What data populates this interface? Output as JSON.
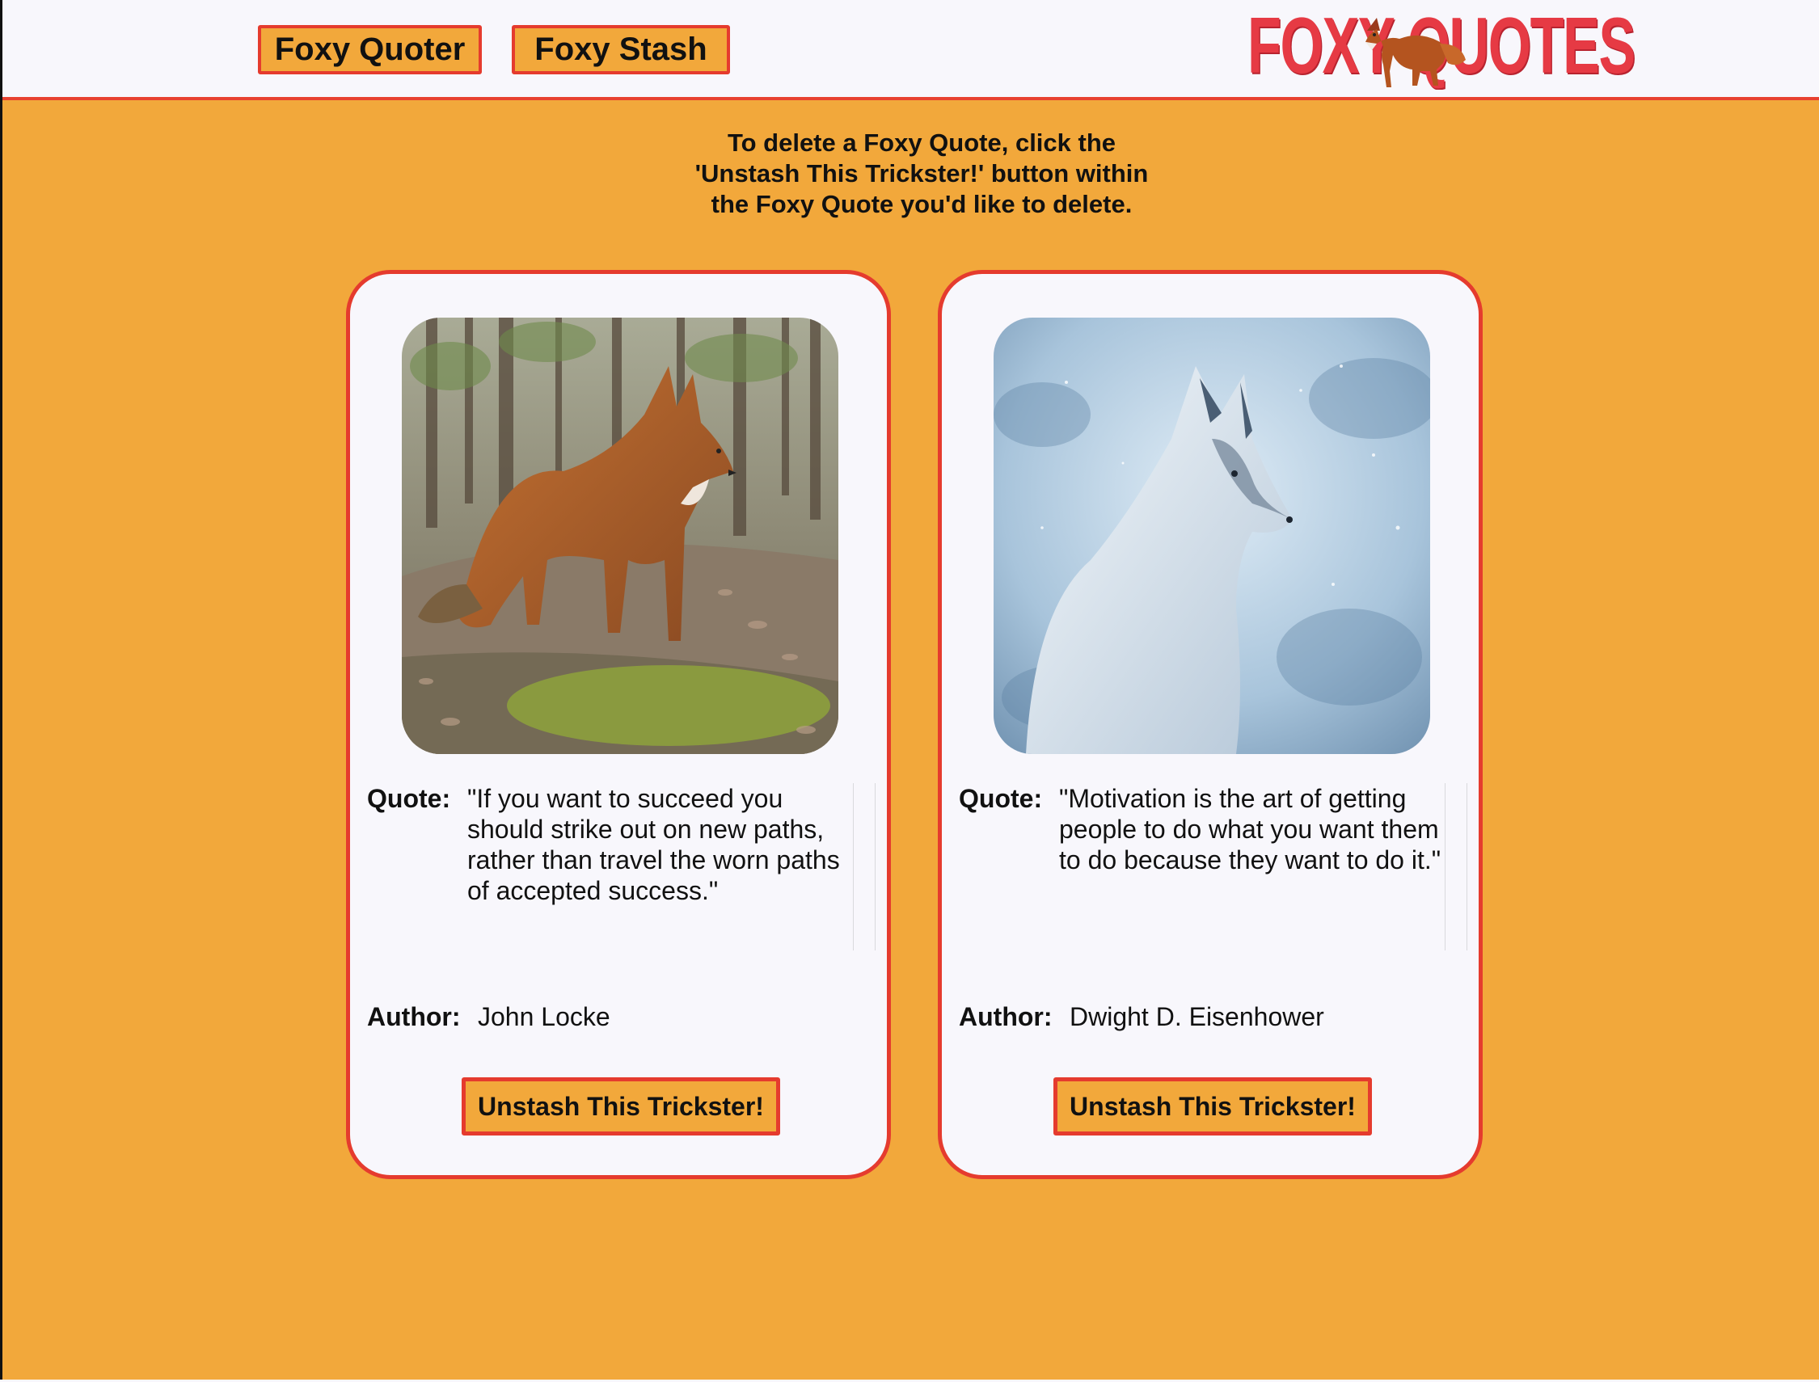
{
  "nav": {
    "quoter_label": "Foxy Quoter",
    "stash_label": "Foxy Stash"
  },
  "logo": {
    "text": "FOXY QUOTES"
  },
  "instructions": {
    "line1": "To delete a Foxy Quote, click the",
    "line2": "'Unstash This Trickster!' button within",
    "line3": "the Foxy Quote you'd like to delete."
  },
  "cards": [
    {
      "quote_label": "Quote:",
      "quote": "\"If you want to succeed you should strike out on new paths, rather than travel the worn paths of accepted success.\"",
      "author_label": "Author:",
      "author": "John Locke",
      "button_label": "Unstash This Trickster!"
    },
    {
      "quote_label": "Quote:",
      "quote": "\"Motivation is the art of getting people to do what you want them to do because they want to do it.\"",
      "author_label": "Author:",
      "author": "Dwight D. Eisenhower",
      "button_label": "Unstash This Trickster!"
    }
  ],
  "colors": {
    "page_background": "#f2a83b",
    "header_background": "#f8f7fc",
    "accent_border": "#e53b2e",
    "logo_red": "#e63a44",
    "card_background": "#f8f7fc"
  }
}
